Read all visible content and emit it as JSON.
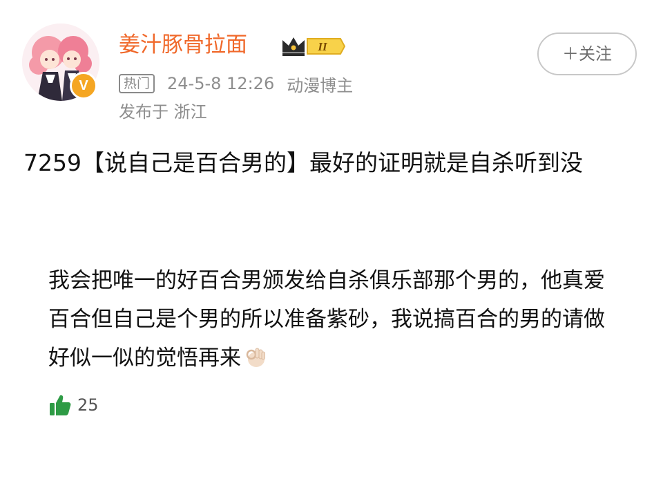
{
  "header": {
    "username": "姜汁豚骨拉面",
    "hot_tag": "热门",
    "timestamp": "24-5-8 12:26",
    "user_type": "动漫博主",
    "location": "发布于 浙江",
    "follow_label": "＋关注",
    "verified_badge": "V",
    "member_level": "II",
    "avatar_icon": "anime-avatar-icon",
    "crown_icon": "crown-badge-icon"
  },
  "post": {
    "title": "7259【说自己是百合男的】最好的证明就是自杀听到没",
    "body": "我会把唯一的好百合男颁发给自杀俱乐部那个男的，他真爱百合但自己是个男的所以准备紫砂，我说搞百合的男的请做好似一似的觉悟再来",
    "emoji": "ok-hand-emoji"
  },
  "reactions": {
    "like_count": "25",
    "like_icon": "thumbs-up-icon"
  },
  "colors": {
    "username": "#f0682a",
    "meta_gray": "#8e8e8e",
    "like_green": "#2e9b45"
  }
}
